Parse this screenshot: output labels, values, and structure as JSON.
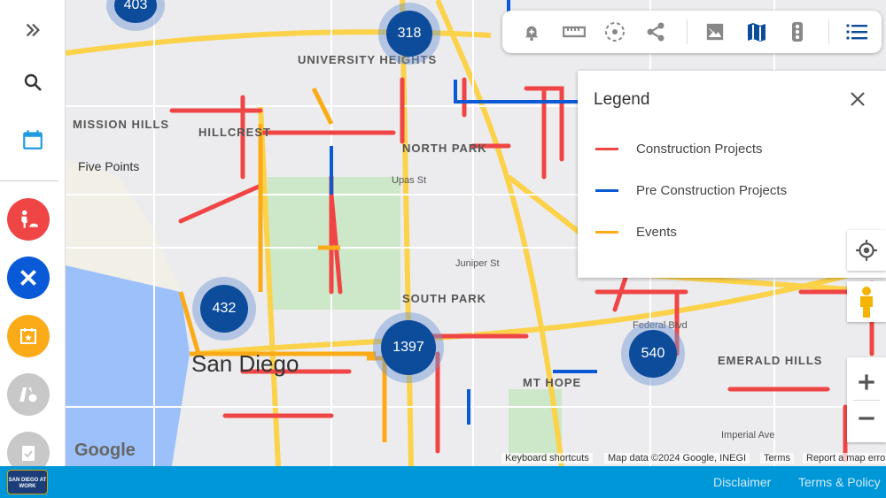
{
  "sidebar": {
    "items": [
      {
        "name": "expand",
        "icon": "double-chevron-right-icon"
      },
      {
        "name": "search",
        "icon": "search-icon"
      },
      {
        "name": "calendar",
        "icon": "calendar-icon",
        "color": "#1e9be0"
      },
      {
        "name": "construction",
        "icon": "construction-worker-icon",
        "color": "#f04545"
      },
      {
        "name": "pre-construction",
        "icon": "tools-icon",
        "color": "#0a5ad8"
      },
      {
        "name": "events",
        "icon": "calendar-star-icon",
        "color": "#fbab18"
      },
      {
        "name": "road-schedule",
        "icon": "road-clock-icon",
        "color": "#c8c8c8"
      },
      {
        "name": "completed",
        "icon": "clipboard-check-icon",
        "color": "#c8c8c8"
      }
    ]
  },
  "toolbar": {
    "icons": [
      "bell-plus-icon",
      "ruler-icon",
      "radius-icon",
      "share-icon",
      "satellite-image-icon",
      "map-icon",
      "traffic-light-icon",
      "list-icon"
    ]
  },
  "legend": {
    "title": "Legend",
    "items": [
      {
        "label": "Construction Projects",
        "color": "#f04545"
      },
      {
        "label": "Pre Construction Projects",
        "color": "#0a5ad8"
      },
      {
        "label": "Events",
        "color": "#fbab18"
      }
    ]
  },
  "map": {
    "clusters": [
      "403",
      "318",
      "432",
      "1397",
      "540"
    ],
    "labels": [
      "UNIVERSITY HEIGHTS",
      "MISSION HILLS",
      "HILLCREST",
      "NORTH PARK",
      "SOUTH PARK",
      "Five Points",
      "San Diego",
      "MT HOPE",
      "EMERALD HILLS",
      "Upas St",
      "Juniper St",
      "Federal Blvd",
      "Imperial Ave"
    ],
    "attribution": [
      "Keyboard shortcuts",
      "Map data ©2024 Google, INEGI",
      "Terms",
      "Report a map error"
    ],
    "google": "Google"
  },
  "footer": {
    "logo": "SAN DIEGO AT WORK",
    "links": [
      "Disclaimer",
      "Terms & Policy"
    ]
  }
}
